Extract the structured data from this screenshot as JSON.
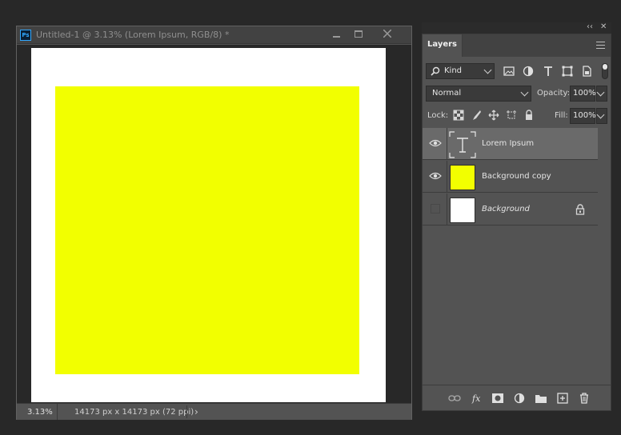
{
  "document": {
    "title": "Untitled-1 @ 3.13% (Lorem Ipsum, RGB/8) *",
    "app_badge": "Ps",
    "canvas_color": "#f2ff00",
    "status": {
      "zoom": "3.13%",
      "size": "14173 px x 14173 px (72 ppi)"
    }
  },
  "layers_panel": {
    "tab": "Layers",
    "filter": {
      "kind": "Kind"
    },
    "blend_mode": "Normal",
    "opacity_label": "Opacity:",
    "opacity": "100%",
    "lock_label": "Lock:",
    "fill_label": "Fill:",
    "fill": "100%",
    "layers": [
      {
        "name": "Lorem Ipsum",
        "type": "text",
        "visible": true,
        "selected": true
      },
      {
        "name": "Background copy",
        "type": "pixel",
        "visible": true,
        "selected": false,
        "thumb_color": "#f2ff00"
      },
      {
        "name": "Background",
        "type": "pixel",
        "visible": false,
        "selected": false,
        "locked": true,
        "italic": true,
        "thumb_color": "#ffffff"
      }
    ]
  },
  "colors": {
    "accent": "#31a8ff",
    "panel_bg": "#535353",
    "workspace_bg": "#282828",
    "selected_row": "#6a6a6a"
  }
}
